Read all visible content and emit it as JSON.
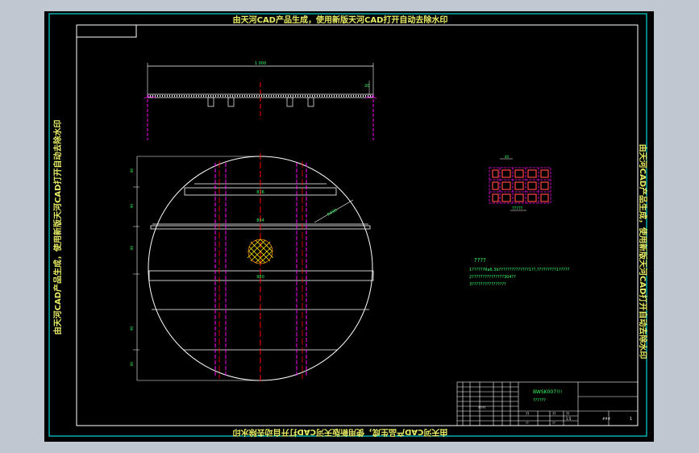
{
  "watermark": "由天河CAD产品生成，使用新版天河CAD打开自动去除水印",
  "drawing": {
    "top_view_width": "1 000",
    "top_view_height": "20",
    "chord_1": "836",
    "chord_2": "884",
    "chord_3": "980",
    "radius": "R490",
    "dims_left": [
      "90",
      "90",
      "90",
      "90",
      "90"
    ],
    "grid_dim": "40",
    "grid_caption": "?????",
    "notes_title": "????",
    "notes": [
      "1??????Ra6.3b??????????????1??,?????????1?????",
      "2???????????????304??",
      "3????????????????"
    ]
  },
  "title_block": {
    "code": "BWSK007!!!",
    "name": "??????",
    "cells": [
      "?????",
      "??",
      "??",
      "??",
      "??",
      "??",
      "1:5"
    ],
    "scale": "1:5",
    "sheet_label": "###",
    "sheet_no": "1"
  },
  "colors": {
    "frame": "#00ffff",
    "centerline": "#ff0000",
    "hidden": "#ff00ff",
    "text": "#33ff66",
    "watermark": "#e8ec64"
  }
}
